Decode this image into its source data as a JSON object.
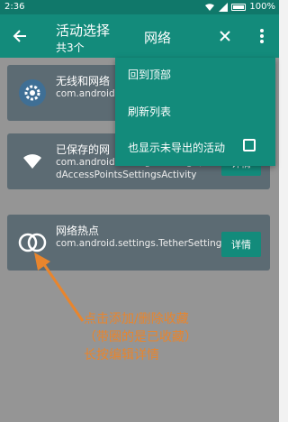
{
  "status_bar": {
    "time": "2:36",
    "battery": "100%"
  },
  "app_bar": {
    "title": "活动选择",
    "subtitle": "共3个",
    "search_text": "网络"
  },
  "cards": [
    {
      "title": "无线和网络",
      "package": "com.android...odeVoiceActi",
      "icon": "settings-gear-icon",
      "detail_label": ""
    },
    {
      "title": "已保存的网",
      "package": "com.android.settings.Settings$SavedAccessPointsSettingsActivity",
      "icon": "wifi-icon",
      "detail_label": "详情"
    },
    {
      "title": "网络热点",
      "package": "com.android.settings.TetherSettings",
      "icon": "hotspot-icon",
      "detail_label": "详情"
    }
  ],
  "menu": {
    "items": [
      {
        "label": "回到顶部"
      },
      {
        "label": "刷新列表"
      },
      {
        "label": "也显示未导出的活动",
        "checked": false
      }
    ]
  },
  "annotation": {
    "lines": [
      "点击添加/删除收藏",
      "（带圈的是已收藏）",
      "长按编辑详情"
    ]
  },
  "colors": {
    "primary": "#138b7b",
    "status_bar": "#10786a",
    "card": "#5c6b73",
    "overlay": "#959595",
    "annotation": "#e8852d"
  }
}
